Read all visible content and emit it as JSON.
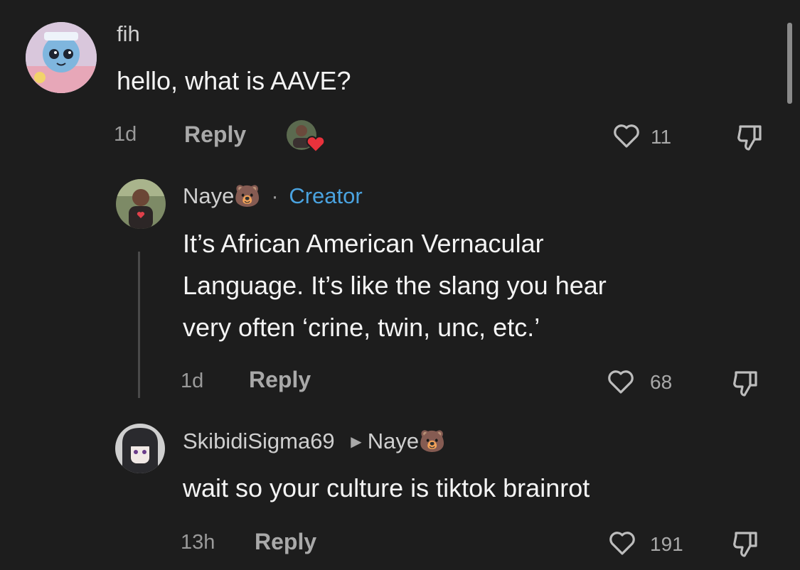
{
  "comments": [
    {
      "username": "fih",
      "text": "hello, what is AAVE?",
      "time": "1d",
      "reply_label": "Reply",
      "likes": "11",
      "avatar_icon": "anime-character-avatar",
      "liked_by_creator_icon": "creator-liked-avatar-with-heart"
    },
    {
      "username": "Naye",
      "username_emoji": "🐻",
      "separator": "·",
      "badge": "Creator",
      "text_lines": [
        "It’s African American Vernacular",
        "Language. It’s like the slang you hear",
        "very often ‘crine, twin, unc, etc.’"
      ],
      "time": "1d",
      "reply_label": "Reply",
      "likes": "68",
      "avatar_icon": "creator-photo-avatar"
    },
    {
      "username": "SkibidiSigma69",
      "reply_to": "Naye",
      "reply_to_emoji": "🐻",
      "text": "wait so your culture is tiktok brainrot",
      "time": "13h",
      "reply_label": "Reply",
      "likes": "191",
      "avatar_icon": "anime-girl-avatar"
    }
  ],
  "colors": {
    "background": "#1d1d1d",
    "creator_badge": "#4aa3e0",
    "heart_red": "#e8323c"
  }
}
